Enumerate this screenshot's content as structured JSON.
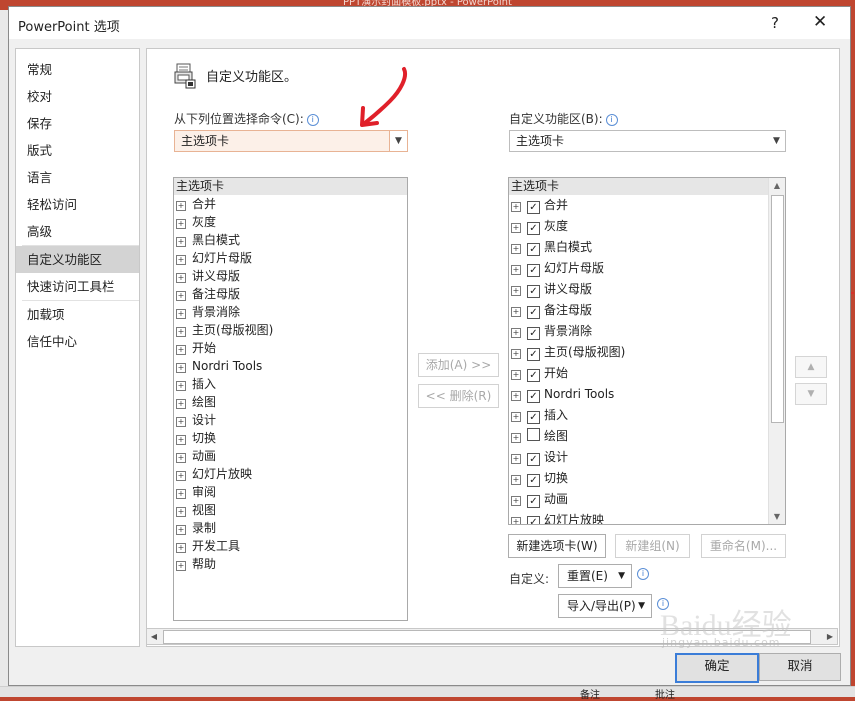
{
  "background": {
    "window_title": "PPT演示封面模板.pptx  -  PowerPoint",
    "statusbar": [
      "备注",
      "批注"
    ]
  },
  "dialog": {
    "title": "PowerPoint 选项",
    "help_glyph": "?",
    "close_glyph": "✕"
  },
  "nav": {
    "items": [
      "常规",
      "校对",
      "保存",
      "版式",
      "语言",
      "轻松访问",
      "高级",
      "自定义功能区",
      "快速访问工具栏",
      "加载项",
      "信任中心"
    ],
    "selected": "自定义功能区"
  },
  "main": {
    "heading": "自定义功能区。",
    "left_label": "从下列位置选择命令(C):",
    "left_combo": "主选项卡",
    "right_label": "自定义功能区(B):",
    "right_combo": "主选项卡",
    "left_list": {
      "header": "主选项卡",
      "items": [
        "合并",
        "灰度",
        "黑白模式",
        "幻灯片母版",
        "讲义母版",
        "备注母版",
        "背景消除",
        "主页(母版视图)",
        "开始",
        "Nordri Tools",
        "插入",
        "绘图",
        "设计",
        "切换",
        "动画",
        "幻灯片放映",
        "审阅",
        "视图",
        "录制",
        "开发工具",
        "帮助"
      ]
    },
    "right_list": {
      "header": "主选项卡",
      "items": [
        {
          "label": "合并",
          "checked": true
        },
        {
          "label": "灰度",
          "checked": true
        },
        {
          "label": "黑白模式",
          "checked": true
        },
        {
          "label": "幻灯片母版",
          "checked": true
        },
        {
          "label": "讲义母版",
          "checked": true
        },
        {
          "label": "备注母版",
          "checked": true
        },
        {
          "label": "背景消除",
          "checked": true
        },
        {
          "label": "主页(母版视图)",
          "checked": true
        },
        {
          "label": "开始",
          "checked": true
        },
        {
          "label": "Nordri Tools",
          "checked": true
        },
        {
          "label": "插入",
          "checked": true
        },
        {
          "label": "绘图",
          "checked": false
        },
        {
          "label": "设计",
          "checked": true
        },
        {
          "label": "切换",
          "checked": true
        },
        {
          "label": "动画",
          "checked": true
        },
        {
          "label": "幻灯片放映",
          "checked": true
        }
      ]
    },
    "add_button": "添加(A) >>",
    "remove_button": "<< 删除(R)",
    "new_tab_button": "新建选项卡(W)",
    "new_group_button": "新建组(N)",
    "rename_button": "重命名(M)...",
    "customize_label": "自定义:",
    "reset_button": "重置(E)",
    "import_export_button": "导入/导出(P)"
  },
  "footer": {
    "ok": "确定",
    "cancel": "取消"
  },
  "watermark": {
    "brand": "Baidu经验",
    "url": "jingyan.baidu.com"
  },
  "colors": {
    "ppt_red": "#bf4630",
    "arrow_red": "#e0202a",
    "focus_blue": "#3b7dd8"
  }
}
